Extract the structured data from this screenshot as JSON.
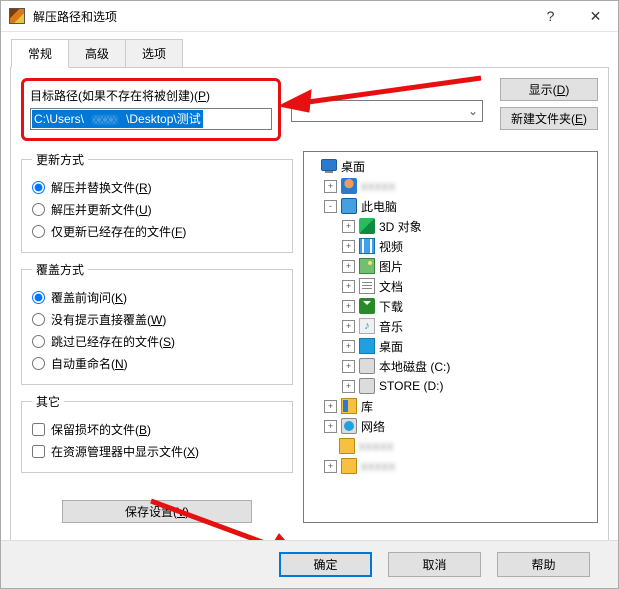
{
  "window": {
    "title": "解压路径和选项"
  },
  "tabs": {
    "general": "常规",
    "advanced": "高级",
    "options": "选项"
  },
  "path": {
    "label_prefix": "目标路径(如果不存在将被创建)(",
    "label_key": "P",
    "value_prefix": "C:\\Users\\",
    "value_suffix": "\\Desktop\\测试"
  },
  "buttons": {
    "display": {
      "text": "显示(",
      "key": "D"
    },
    "new_folder": {
      "text": "新建文件夹(",
      "key": "E"
    },
    "save_settings": {
      "text": "保存设置(",
      "key": "V"
    },
    "ok": "确定",
    "cancel": "取消",
    "help": "帮助"
  },
  "update_mode": {
    "legend": "更新方式",
    "items": [
      {
        "label": "解压并替换文件(",
        "key": "R",
        "checked": true
      },
      {
        "label": "解压并更新文件(",
        "key": "U",
        "checked": false
      },
      {
        "label": "仅更新已经存在的文件(",
        "key": "F",
        "checked": false
      }
    ]
  },
  "overwrite_mode": {
    "legend": "覆盖方式",
    "items": [
      {
        "label": "覆盖前询问(",
        "key": "K",
        "checked": true
      },
      {
        "label": "没有提示直接覆盖(",
        "key": "W",
        "checked": false
      },
      {
        "label": "跳过已经存在的文件(",
        "key": "S",
        "checked": false
      },
      {
        "label": "自动重命名(",
        "key": "N",
        "checked": false
      }
    ]
  },
  "other": {
    "legend": "其它",
    "items": [
      {
        "label": "保留损坏的文件(",
        "key": "B"
      },
      {
        "label": "在资源管理器中显示文件(",
        "key": "X"
      }
    ]
  },
  "tree": [
    {
      "level": 0,
      "exp": "",
      "icon": "monitor",
      "label": "桌面"
    },
    {
      "level": 1,
      "exp": "+",
      "icon": "user",
      "blur": true
    },
    {
      "level": 1,
      "exp": "-",
      "icon": "pc",
      "label": "此电脑"
    },
    {
      "level": 2,
      "exp": "+",
      "icon": "cube",
      "label": "3D 对象"
    },
    {
      "level": 2,
      "exp": "+",
      "icon": "film",
      "label": "视频"
    },
    {
      "level": 2,
      "exp": "+",
      "icon": "img",
      "label": "图片"
    },
    {
      "level": 2,
      "exp": "+",
      "icon": "doc",
      "label": "文档"
    },
    {
      "level": 2,
      "exp": "+",
      "icon": "down",
      "label": "下载"
    },
    {
      "level": 2,
      "exp": "+",
      "icon": "music",
      "label": "音乐"
    },
    {
      "level": 2,
      "exp": "+",
      "icon": "desk",
      "label": "桌面"
    },
    {
      "level": 2,
      "exp": "+",
      "icon": "drive",
      "label": "本地磁盘 (C:)"
    },
    {
      "level": 2,
      "exp": "+",
      "icon": "drive",
      "label": "STORE (D:)"
    },
    {
      "level": 1,
      "exp": "+",
      "icon": "lib",
      "label": "库"
    },
    {
      "level": 1,
      "exp": "+",
      "icon": "net",
      "label": "网络"
    },
    {
      "level": 1,
      "exp": "",
      "icon": "folder",
      "blur": true
    },
    {
      "level": 1,
      "exp": "+",
      "icon": "folder",
      "blur": true
    }
  ]
}
